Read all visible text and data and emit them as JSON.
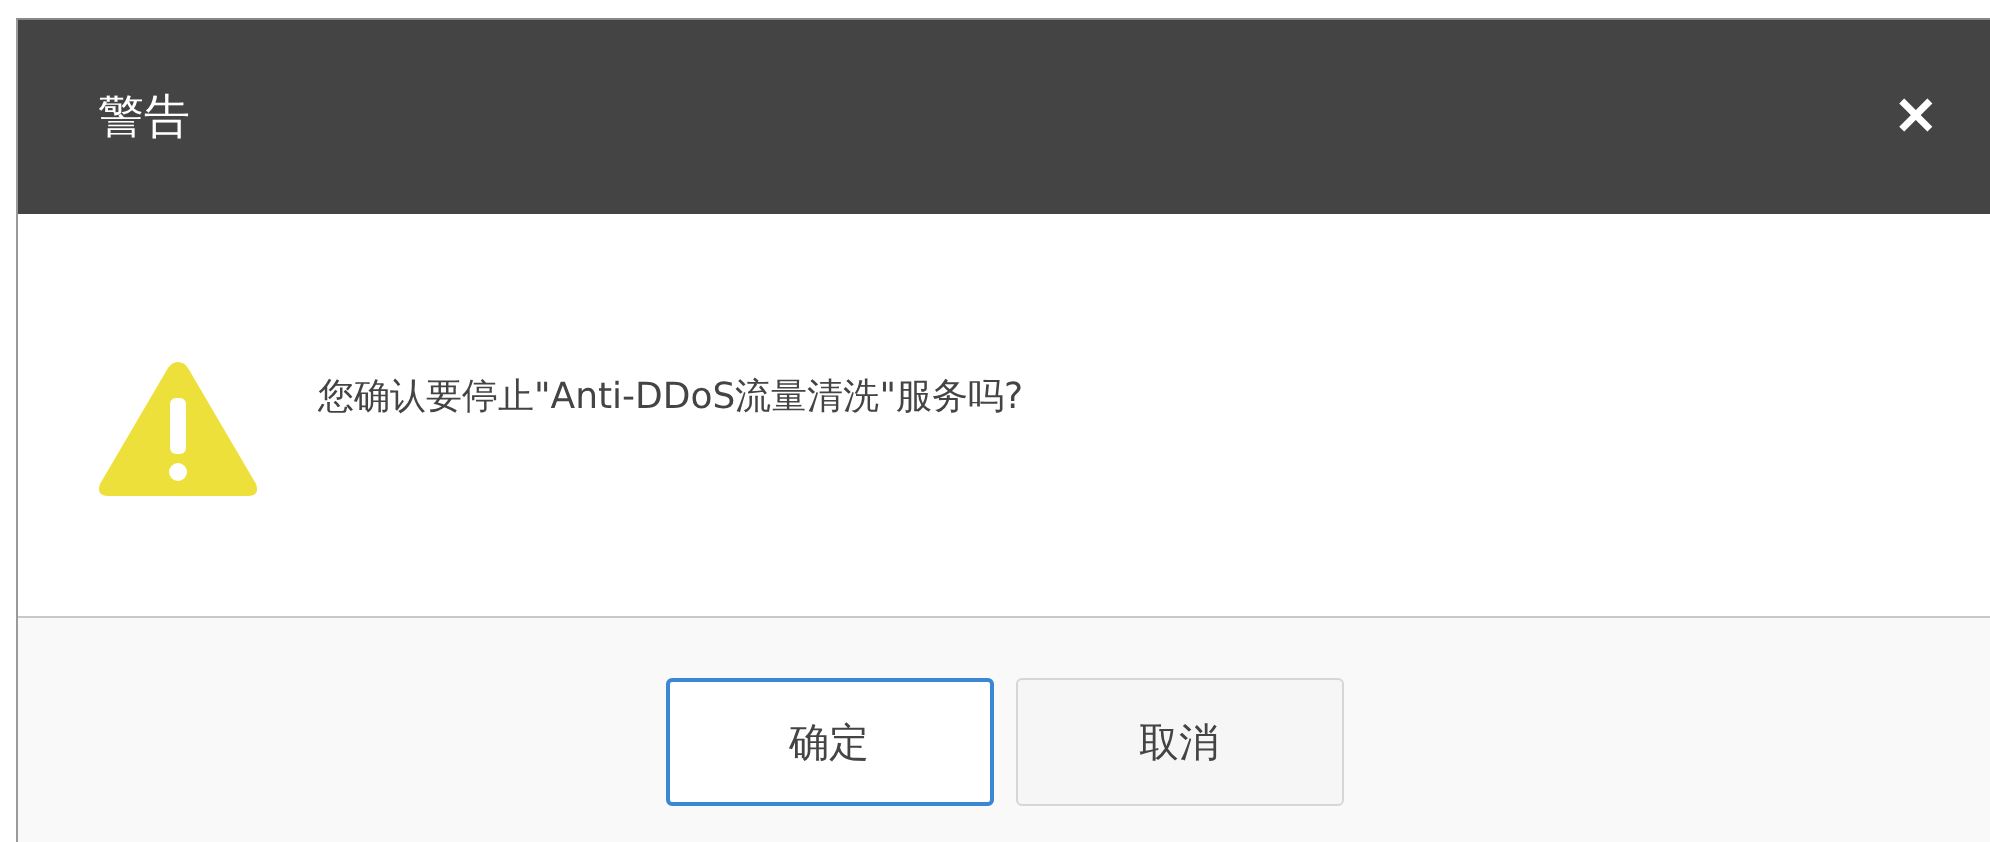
{
  "dialog": {
    "title": "警告",
    "close": "✕",
    "message": "您确认要停止\"Anti-DDoS流量清洗\"服务吗?"
  },
  "buttons": [
    {
      "label": "确定",
      "kind": "primary"
    },
    {
      "label": "取消",
      "kind": "secondary"
    }
  ]
}
